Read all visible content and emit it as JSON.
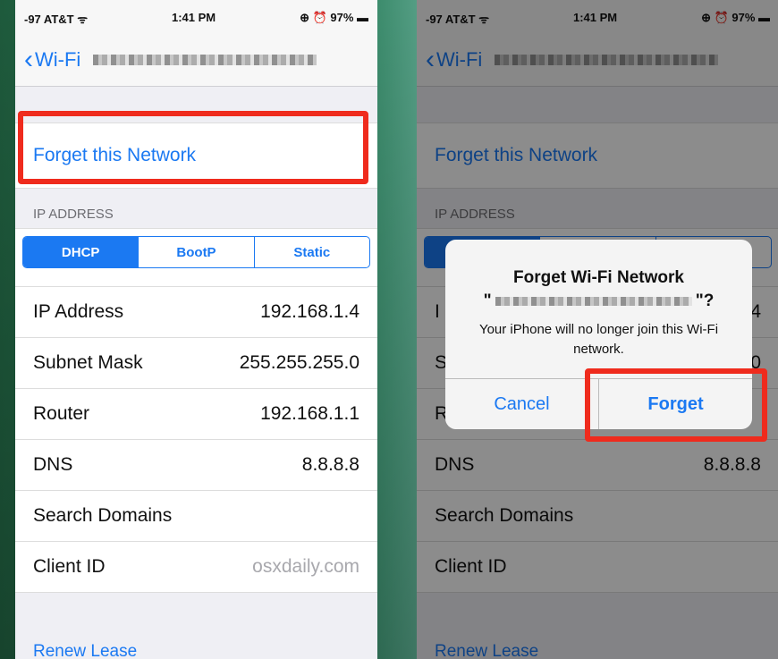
{
  "status": {
    "carrier": "-97 AT&T ᯤ",
    "time": "1:41 PM",
    "right": "⊕ ⏰ 97% ▬"
  },
  "nav": {
    "back_label": "Wi-Fi"
  },
  "forget_network": "Forget this Network",
  "section_ip": "IP ADDRESS",
  "segments": [
    "DHCP",
    "BootP",
    "Static"
  ],
  "rows": [
    {
      "label": "IP Address",
      "value": "192.168.1.4"
    },
    {
      "label": "Subnet Mask",
      "value": "255.255.255.0"
    },
    {
      "label": "Router",
      "value": "192.168.1.1"
    },
    {
      "label": "DNS",
      "value": "8.8.8.8"
    },
    {
      "label": "Search Domains",
      "value": ""
    },
    {
      "label": "Client ID",
      "value": "osxdaily.com"
    }
  ],
  "right_rows": [
    {
      "label": "I",
      "value": "4"
    },
    {
      "label": "S",
      "value": "0"
    },
    {
      "label": "R",
      "value": ""
    },
    {
      "label": "DNS",
      "value": "8.8.8.8"
    },
    {
      "label": "Search Domains",
      "value": ""
    },
    {
      "label": "Client ID",
      "value": ""
    }
  ],
  "renew": "Renew Lease",
  "alert": {
    "title": "Forget Wi-Fi Network",
    "quote_open": "\"",
    "quote_close": "\"?",
    "message": "Your iPhone will no longer join this Wi-Fi network.",
    "cancel": "Cancel",
    "forget": "Forget"
  },
  "colors": {
    "accent": "#1b79f2",
    "highlight": "#ef2b1d"
  }
}
